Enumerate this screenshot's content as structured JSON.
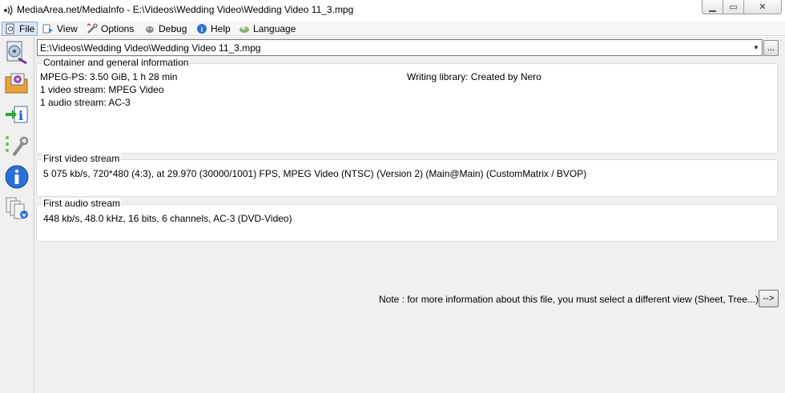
{
  "window": {
    "title": "MediaArea.net/MediaInfo - E:\\Videos\\Wedding Video\\Wedding Video 11_3.mpg",
    "controls": {
      "minimize": "▁",
      "maximize": "▭",
      "close": "✕"
    }
  },
  "menu": {
    "items": [
      {
        "label": "File",
        "icon": "file-icon",
        "active": true
      },
      {
        "label": "View",
        "icon": "view-icon"
      },
      {
        "label": "Options",
        "icon": "options-icon"
      },
      {
        "label": "Debug",
        "icon": "debug-icon"
      },
      {
        "label": "Help",
        "icon": "help-icon"
      },
      {
        "label": "Language",
        "icon": "language-icon"
      }
    ]
  },
  "sidebar": {
    "buttons": [
      "open-file-icon",
      "open-folder-icon",
      "export-icon",
      "preferences-icon",
      "about-icon",
      "knowledge-base-icon"
    ]
  },
  "file_selector": {
    "value": "E:\\Videos\\Wedding Video\\Wedding Video 11_3.mpg",
    "arrow": "▼",
    "browse_label": "..."
  },
  "general": {
    "legend": "Container and general information",
    "format_line": "MPEG-PS: 3.50 GiB, 1 h 28 min",
    "writing_library": "Writing library: Created by Nero",
    "video_count": "1 video stream: MPEG Video",
    "audio_count": "1 audio stream: AC-3"
  },
  "video": {
    "legend": "First video stream",
    "details": "5 075 kb/s, 720*480 (4:3), at 29.970 (30000/1001) FPS, MPEG Video (NTSC) (Version 2) (Main@Main) (CustomMatrix / BVOP)"
  },
  "audio": {
    "legend": "First audio stream",
    "details": "448 kb/s, 48.0 kHz, 16 bits, 6 channels, AC-3 (DVD-Video)"
  },
  "footer": {
    "note": "Note : for more information about this file, you must select a different view (Sheet, Tree...)",
    "next_label": "-->"
  }
}
